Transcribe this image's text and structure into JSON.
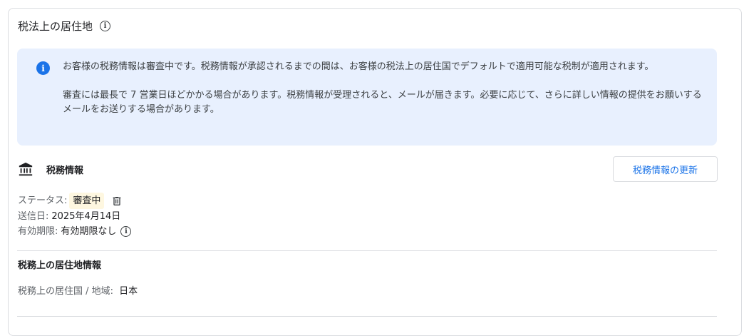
{
  "section": {
    "title": "税法上の居住地"
  },
  "notice": {
    "paragraph1": "お客様の税務情報は審査中です。税務情報が承認されるまでの間は、お客様の税法上の居住国でデフォルトで適用可能な税制が適用されます。",
    "paragraph2": "審査には最長で 7 営業日ほどかかる場合があります。税務情報が受理されると、メールが届きます。必要に応じて、さらに詳しい情報の提供をお願いするメールをお送りする場合があります。"
  },
  "tax_info": {
    "label": "税務情報",
    "update_button": "税務情報の更新",
    "status_label": "ステータス:",
    "status_value": "審査中",
    "sent_label": "送信日:",
    "sent_value": "2025年4月14日",
    "expiry_label": "有効期限:",
    "expiry_value": "有効期限なし"
  },
  "residency": {
    "heading": "税務上の居住地情報",
    "country_label": "税務上の居住国 / 地域:",
    "country_value": "日本"
  },
  "colors": {
    "accent": "#1a73e8",
    "notice_bg": "#e8f0fe",
    "badge_bg": "#fef7e0"
  },
  "icons": [
    "info-outline-icon",
    "info-filled-icon",
    "bank-icon",
    "trash-icon"
  ]
}
